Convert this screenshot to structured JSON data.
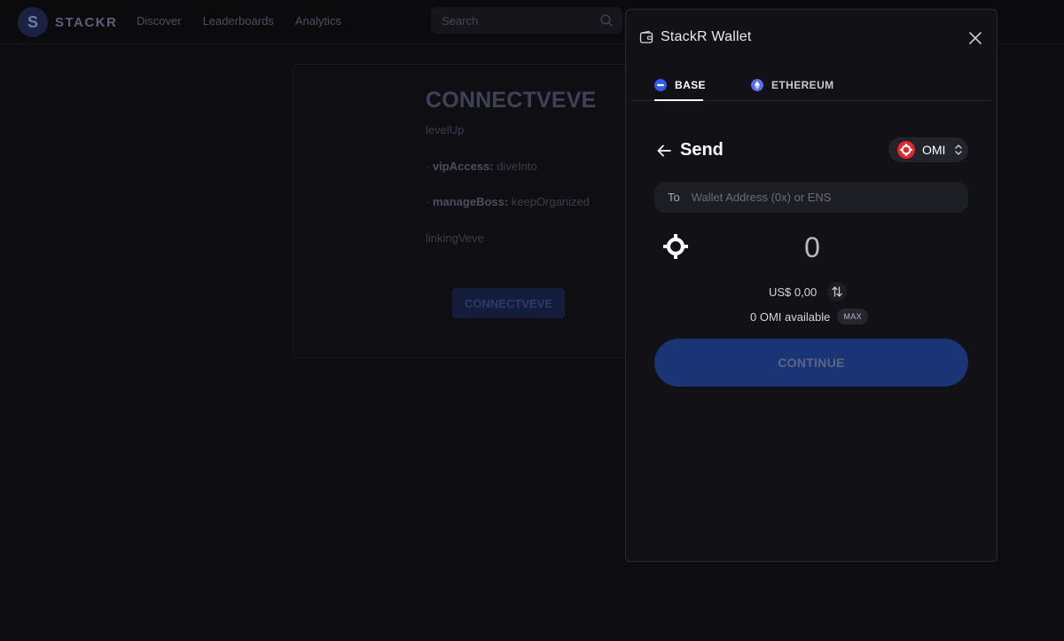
{
  "app": {
    "brand": "STACKR",
    "logo_letter": "S",
    "nav": [
      "Discover",
      "Leaderboards",
      "Analytics"
    ],
    "search_placeholder": "Search"
  },
  "card": {
    "title": "CONNECTVEVE",
    "subtitle": "levelUp",
    "rows": [
      {
        "key": "vipAccess:",
        "value": "diveInto"
      },
      {
        "key": "manageBoss:",
        "value": "keepOrganized"
      }
    ],
    "link": "linkingVeve",
    "button": "CONNECTVEVE"
  },
  "wallet": {
    "title": "StackR Wallet",
    "tabs": [
      {
        "label": "BASE",
        "color": "#2f5cf5"
      },
      {
        "label": "ETHEREUM",
        "color": "#5b6cf0"
      }
    ],
    "send_title": "Send",
    "token": {
      "symbol": "OMI",
      "color": "#e5242c"
    },
    "to_label": "To",
    "to_placeholder": "Wallet Address (0x) or ENS",
    "amount": "0",
    "fiat": "US$ 0,00",
    "available": "0 OMI available",
    "max_label": "MAX",
    "continue_label": "CONTINUE"
  }
}
